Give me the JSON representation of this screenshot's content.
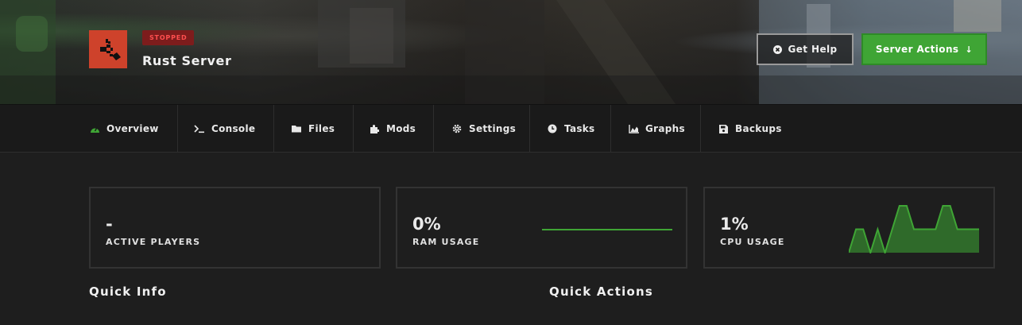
{
  "server": {
    "name": "Rust Server",
    "status": "STOPPED",
    "icon": "rust-logo-icon"
  },
  "header_buttons": {
    "help_label": "Get Help",
    "actions_label": "Server Actions",
    "actions_arrow": "↓"
  },
  "nav": {
    "tabs": [
      {
        "label": "Overview",
        "icon": "dashboard-icon",
        "active": true
      },
      {
        "label": "Console",
        "icon": "terminal-icon"
      },
      {
        "label": "Files",
        "icon": "folder-icon"
      },
      {
        "label": "Mods",
        "icon": "puzzle-icon"
      },
      {
        "label": "Settings",
        "icon": "gear-icon"
      },
      {
        "label": "Tasks",
        "icon": "clock-icon"
      },
      {
        "label": "Graphs",
        "icon": "area-chart-icon"
      },
      {
        "label": "Backups",
        "icon": "save-icon"
      }
    ]
  },
  "stats": {
    "players": {
      "value": "-",
      "label": "ACTIVE PLAYERS"
    },
    "ram": {
      "value": "0%",
      "label": "RAM USAGE"
    },
    "cpu": {
      "value": "1%",
      "label": "CPU USAGE"
    }
  },
  "sections": {
    "quick_info": "Quick Info",
    "quick_actions": "Quick Actions"
  },
  "colors": {
    "accent_green": "#3fa535",
    "status_red": "#ff4f4f",
    "rust_orange": "#ce422b"
  },
  "chart_data": [
    {
      "type": "line",
      "title": "RAM USAGE",
      "values": [
        0,
        0,
        0,
        0,
        0,
        0,
        0,
        0,
        0,
        0,
        0,
        0,
        0,
        0,
        0,
        0,
        0,
        0,
        0,
        0
      ],
      "ylim": [
        0,
        2
      ]
    },
    {
      "type": "area",
      "title": "CPU USAGE",
      "values": [
        0,
        1,
        1,
        0,
        1,
        0,
        1,
        2,
        2,
        1,
        1,
        1,
        1,
        2,
        2,
        1,
        1,
        1,
        1
      ],
      "ylim": [
        0,
        2
      ]
    }
  ]
}
